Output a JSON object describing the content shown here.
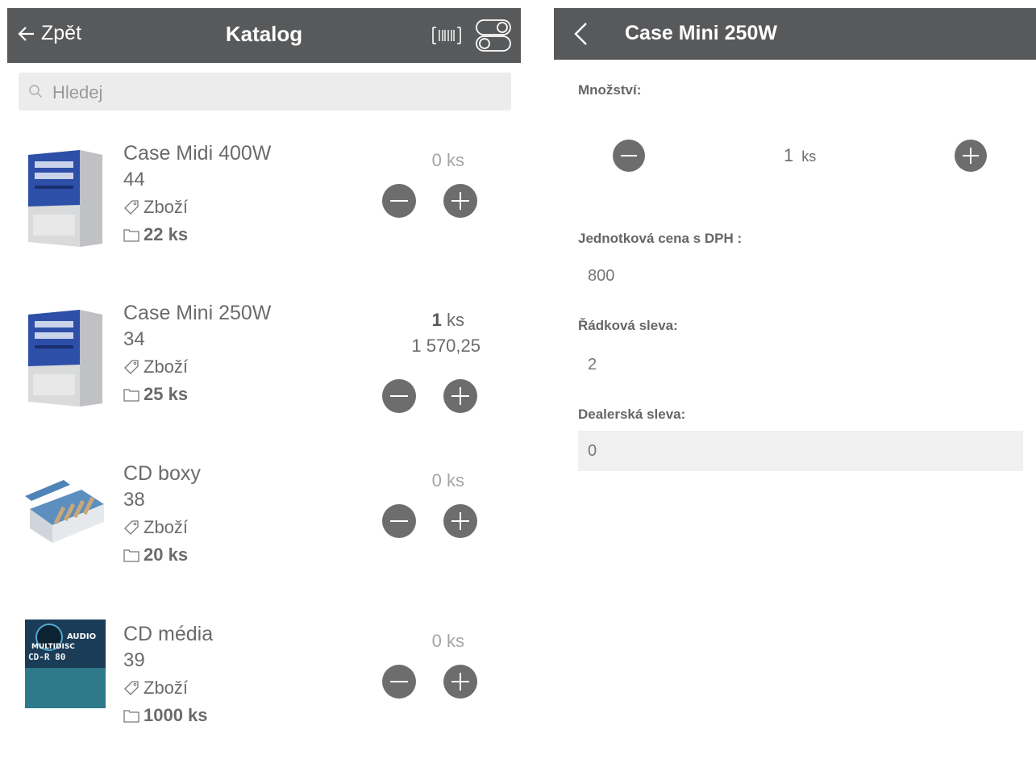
{
  "catalog": {
    "back_label": "Zpět",
    "title": "Katalog",
    "search_placeholder": "Hledej",
    "items": [
      {
        "name": "Case Midi 400W",
        "code": "44",
        "category": "Zboží",
        "stock": "22 ks",
        "qty": "0",
        "unit": "ks",
        "price": ""
      },
      {
        "name": "Case Mini 250W",
        "code": "34",
        "category": "Zboží",
        "stock": "25 ks",
        "qty": "1",
        "unit": "ks",
        "price": "1 570,25"
      },
      {
        "name": "CD boxy",
        "code": "38",
        "category": "Zboží",
        "stock": "20 ks",
        "qty": "0",
        "unit": "ks",
        "price": ""
      },
      {
        "name": "CD média",
        "code": "39",
        "category": "Zboží",
        "stock": "1000 ks",
        "qty": "0",
        "unit": "ks",
        "price": ""
      }
    ],
    "cd_cover_text": {
      "line1": "AUDIO",
      "line2": "MULTIDISC",
      "line3": "CD-R 80"
    }
  },
  "detail": {
    "title": "Case Mini 250W",
    "quantity_label": "Množství:",
    "quantity_value": "1",
    "quantity_unit": "ks",
    "unit_price_label": "Jednotková cena s DPH :",
    "unit_price_value": "800",
    "line_discount_label": "Řádková sleva:",
    "line_discount_value": "2",
    "dealer_discount_label": "Dealerská sleva:",
    "dealer_discount_value": "0"
  },
  "colors": {
    "header": "#58595b",
    "button": "#6d6d6d",
    "field": "#f0f0f0"
  }
}
